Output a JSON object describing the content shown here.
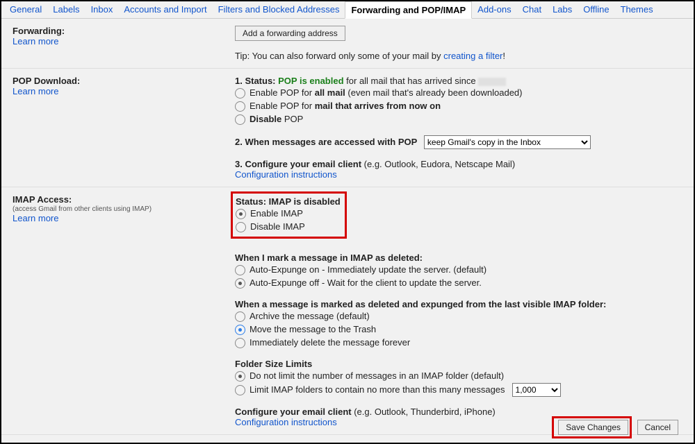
{
  "tabs": [
    "General",
    "Labels",
    "Inbox",
    "Accounts and Import",
    "Filters and Blocked Addresses",
    "Forwarding and POP/IMAP",
    "Add-ons",
    "Chat",
    "Labs",
    "Offline",
    "Themes"
  ],
  "active_tab": 5,
  "forwarding": {
    "title": "Forwarding:",
    "learn": "Learn more",
    "add_btn": "Add a forwarding address",
    "tip_pre": "Tip: You can also forward only some of your mail by ",
    "tip_link": "creating a filter",
    "tip_post": "!"
  },
  "pop": {
    "title": "POP Download:",
    "learn": "Learn more",
    "s1_pre": "1. Status: ",
    "s1_status": "POP is enabled",
    "s1_post": " for all mail that has arrived since ",
    "r1_pre": "Enable POP for ",
    "r1_bold": "all mail",
    "r1_post": " (even mail that's already been downloaded)",
    "r2_pre": "Enable POP for ",
    "r2_bold": "mail that arrives from now on",
    "r3_bold": "Disable",
    "r3_post": " POP",
    "s2": "2. When messages are accessed with POP",
    "s2_select": "keep Gmail's copy in the Inbox",
    "s3_bold": "3. Configure your email client",
    "s3_post": " (e.g. Outlook, Eudora, Netscape Mail)",
    "s3_link": "Configuration instructions"
  },
  "imap": {
    "title": "IMAP Access:",
    "sub": "(access Gmail from other clients using IMAP)",
    "learn": "Learn more",
    "status_lbl": "Status: ",
    "status_val": "IMAP is disabled",
    "r_enable": "Enable IMAP",
    "r_disable": "Disable IMAP",
    "del_h": "When I mark a message in IMAP as deleted:",
    "del_r1": "Auto-Expunge on - Immediately update the server. (default)",
    "del_r2": "Auto-Expunge off - Wait for the client to update the server.",
    "exp_h": "When a message is marked as deleted and expunged from the last visible IMAP folder:",
    "exp_r1": "Archive the message (default)",
    "exp_r2": "Move the message to the Trash",
    "exp_r3": "Immediately delete the message forever",
    "fsl_h": "Folder Size Limits",
    "fsl_r1": "Do not limit the number of messages in an IMAP folder (default)",
    "fsl_r2": "Limit IMAP folders to contain no more than this many messages",
    "fsl_sel": "1,000",
    "cfg_bold": "Configure your email client",
    "cfg_post": " (e.g. Outlook, Thunderbird, iPhone)",
    "cfg_link": "Configuration instructions"
  },
  "footer": {
    "save": "Save Changes",
    "cancel": "Cancel"
  }
}
